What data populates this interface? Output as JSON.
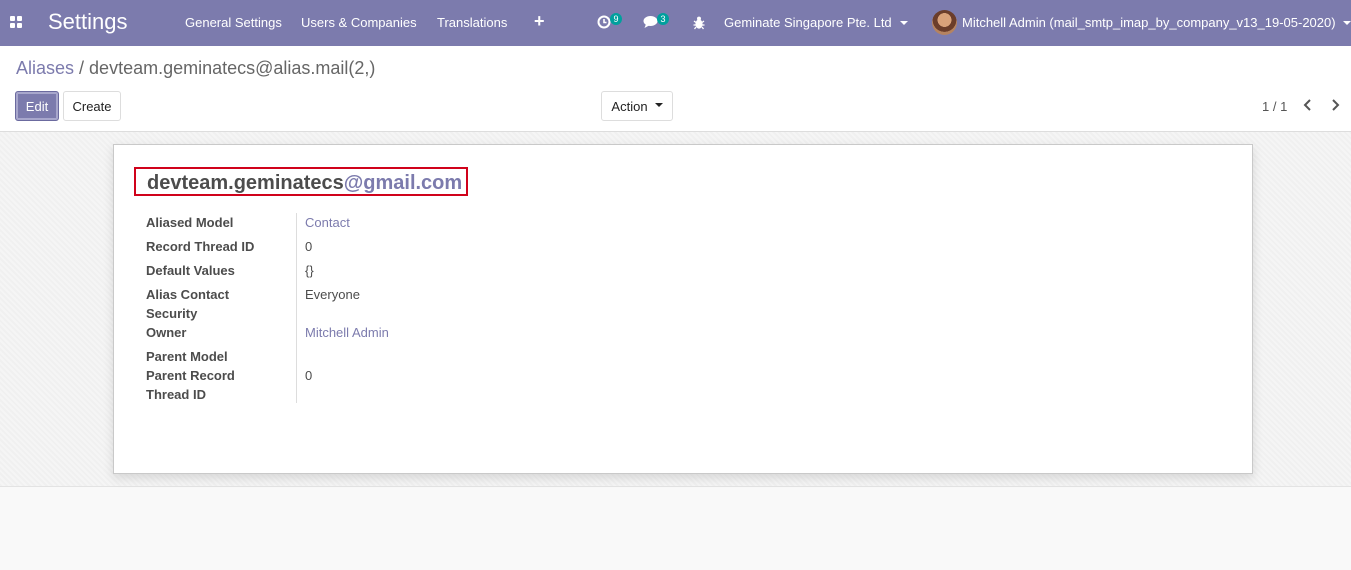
{
  "navbar": {
    "app_title": "Settings",
    "menu": [
      "General Settings",
      "Users & Companies",
      "Translations"
    ],
    "plus_label": "+",
    "activity_count": "9",
    "messages_count": "3",
    "company": "Geminate Singapore Pte. Ltd",
    "user": "Mitchell Admin (mail_smtp_imap_by_company_v13_19-05-2020)"
  },
  "breadcrumb": {
    "parent": "Aliases",
    "separator": "/",
    "current": "devteam.geminatecs@alias.mail(2,)"
  },
  "toolbar": {
    "edit_label": "Edit",
    "create_label": "Create",
    "action_label": "Action"
  },
  "pager": {
    "value": "1 / 1"
  },
  "record": {
    "alias_name": "devteam.geminatecs",
    "alias_domain": "@gmail.com",
    "fields": [
      {
        "label": "Aliased Model",
        "value": "Contact"
      },
      {
        "label": "Record Thread ID",
        "value": "0"
      },
      {
        "label": "Default Values",
        "value": "{}"
      },
      {
        "label": "Alias Contact Security",
        "value": "Everyone"
      },
      {
        "label": "Owner",
        "value": "Mitchell Admin"
      },
      {
        "label": "Parent Model",
        "value": ""
      },
      {
        "label": "Parent Record Thread ID",
        "value": "0"
      }
    ]
  },
  "colors": {
    "navbar": "#7c7bad",
    "link": "#7c7bad",
    "badge": "#00a09d",
    "highlight_border": "#d0021b"
  }
}
